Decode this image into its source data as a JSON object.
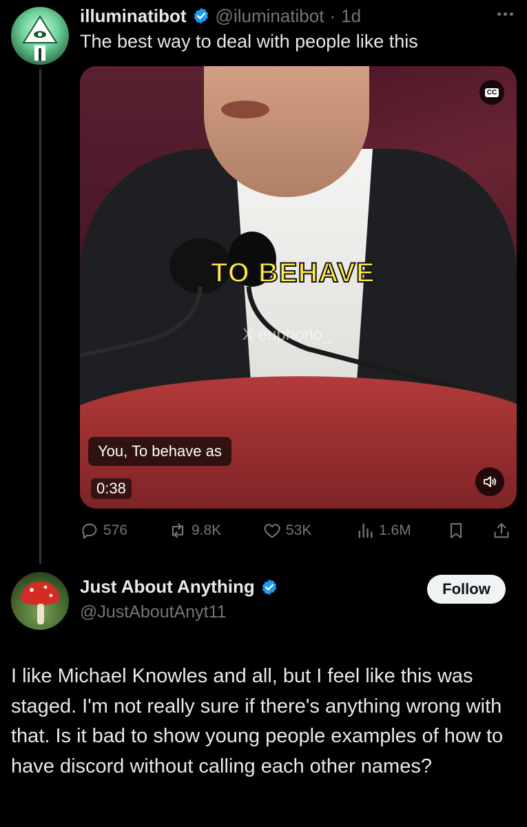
{
  "tweet": {
    "author_name": "illuminatibot",
    "author_handle": "@iluminatibot",
    "separator": "·",
    "time": "1d",
    "text": "The best way to deal with people like this",
    "video": {
      "burned_caption": "TO BEHAVE",
      "watermark": "X euphorio_",
      "cc_label": "CC",
      "subtitle": "You, To behave as",
      "duration": "0:38"
    },
    "stats": {
      "replies": "576",
      "reposts": "9.8K",
      "likes": "53K",
      "views": "1.6M"
    }
  },
  "reply": {
    "author_name": "Just About Anything",
    "author_handle": "@JustAboutAnyt11",
    "follow_label": "Follow",
    "text": "I like Michael Knowles and all, but I feel like this was staged. I'm not really sure if there's anything wrong with that. Is it bad to show young people examples of how to have discord without calling each other names?"
  },
  "colors": {
    "background": "#000000",
    "text_primary": "#e7e9ea",
    "text_secondary": "#71767b",
    "verified_blue": "#1d9bf0",
    "caption_yellow": "#ffe84a"
  },
  "icons": [
    "reply-icon",
    "repost-icon",
    "like-icon",
    "views-icon",
    "bookmark-icon",
    "share-icon",
    "verified-icon",
    "more-icon",
    "cc-icon",
    "volume-icon"
  ]
}
